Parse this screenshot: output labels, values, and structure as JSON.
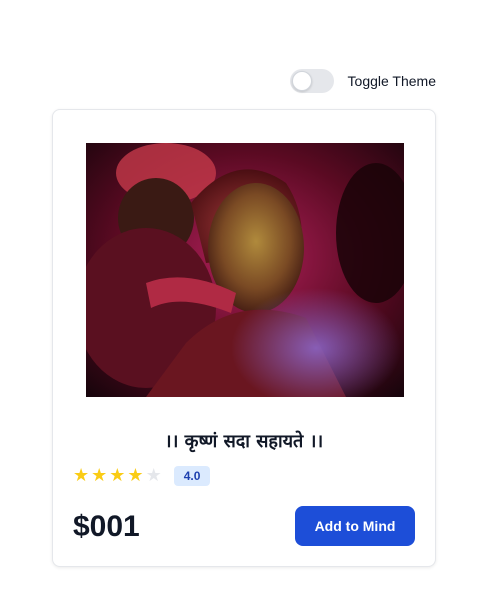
{
  "theme_toggle": {
    "label": "Toggle Theme",
    "on": false
  },
  "product": {
    "image_alt": "Portrait of a man covered in Holi colours",
    "title": "।। कृष्णं सदा सहायते ।।",
    "rating": 4,
    "rating_max": 5,
    "rating_label": "4.0",
    "price": "$001",
    "add_button_label": "Add to Mind"
  },
  "colors": {
    "accent": "#1d4ed8",
    "star_on": "#facc15",
    "star_off": "#e5e7eb",
    "badge_bg": "#dbeafe",
    "badge_text": "#1e40af"
  }
}
